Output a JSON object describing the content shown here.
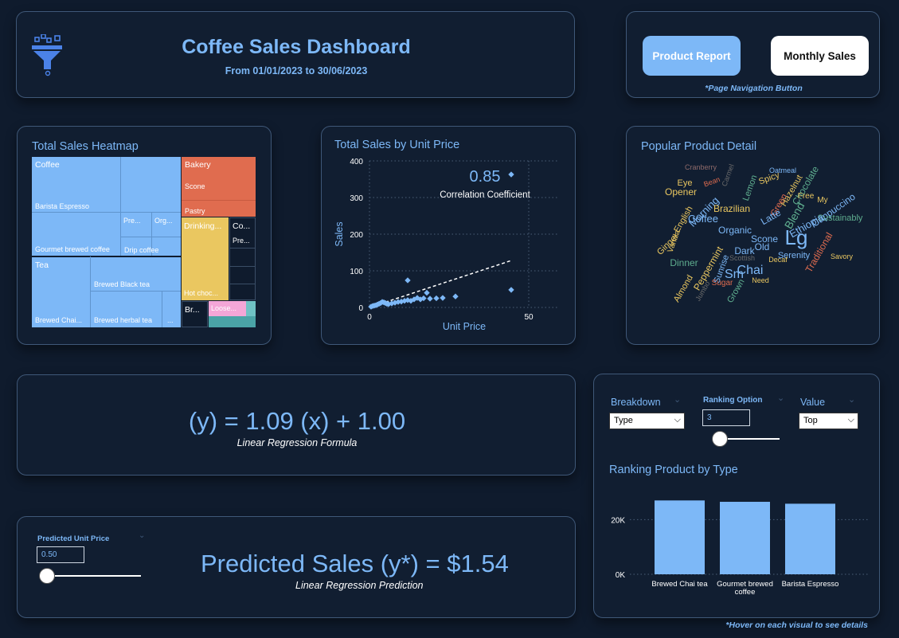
{
  "header": {
    "title": "Coffee Sales Dashboard",
    "subtitle": "From 01/01/2023 to 30/06/2023",
    "logo_icon": "funnel-icon"
  },
  "nav": {
    "product_label": "Product Report",
    "monthly_label": "Monthly Sales",
    "note": "*Page Navigation Button"
  },
  "heatmap": {
    "title": "Total Sales Heatmap",
    "labels": {
      "coffee": "Coffee",
      "barista": "Barista Espresso",
      "pre1": "Pre...",
      "org": "Org...",
      "gourmet": "Gourmet brewed coffee",
      "drip": "Drip coffee",
      "tea": "Tea",
      "black": "Brewed Black tea",
      "chai": "Brewed Chai...",
      "herbal": "Brewed herbal tea",
      "dots": "...",
      "bakery": "Bakery",
      "scone": "Scone",
      "pastry": "Pastry",
      "drinking": "Drinking...",
      "hotchoc": "Hot choc...",
      "co": "Co...",
      "pre2": "Pre...",
      "br": "Br...",
      "loose": "Loose..."
    },
    "colors": {
      "coffee": "#7db8f7",
      "bakery": "#e06c4f",
      "drinking": "#eac760",
      "loose": "#f4a6d7",
      "dark": "#0f1b2d"
    }
  },
  "scatter": {
    "title": "Total Sales by Unit Price",
    "correlation_value": "0.85",
    "correlation_label": "Correlation Coefficient"
  },
  "chart_data": [
    {
      "type": "scatter",
      "title": "Total Sales by Unit Price",
      "xlabel": "Unit Price",
      "ylabel": "Sales",
      "xlim": [
        0,
        50
      ],
      "ylim": [
        0,
        400
      ],
      "xticks": [
        "0",
        "50"
      ],
      "yticks": [
        "0",
        "100",
        "200",
        "300",
        "400"
      ],
      "trendline": [
        [
          0,
          0
        ],
        [
          44.5,
          128
        ]
      ],
      "points": [
        [
          0.5,
          2
        ],
        [
          1,
          4
        ],
        [
          1.5,
          5
        ],
        [
          2,
          6
        ],
        [
          2.5,
          8
        ],
        [
          3,
          10
        ],
        [
          3.5,
          12
        ],
        [
          4,
          15
        ],
        [
          4.5,
          14
        ],
        [
          5,
          12
        ],
        [
          5.5,
          10
        ],
        [
          6,
          9
        ],
        [
          7,
          11
        ],
        [
          8,
          13
        ],
        [
          9,
          15
        ],
        [
          10,
          16
        ],
        [
          11,
          18
        ],
        [
          12,
          20
        ],
        [
          12,
          74
        ],
        [
          13,
          18
        ],
        [
          14,
          22
        ],
        [
          15,
          26
        ],
        [
          16,
          22
        ],
        [
          17,
          25
        ],
        [
          18,
          40
        ],
        [
          19,
          24
        ],
        [
          21,
          25
        ],
        [
          23,
          26
        ],
        [
          27,
          30
        ],
        [
          44.5,
          48
        ],
        [
          44.5,
          363
        ]
      ]
    },
    {
      "type": "bar",
      "title": "Ranking Product by Type",
      "categories": [
        "Brewed Chai tea",
        "Gourmet brewed coffee",
        "Barista Espresso"
      ],
      "values": [
        27000,
        26500,
        25800
      ],
      "ylim": [
        0,
        30000
      ],
      "yticks": [
        "0K",
        "20K"
      ]
    }
  ],
  "wordcloud": {
    "title": "Popular Product Detail",
    "words": [
      {
        "t": "Cranberry",
        "c": "#8e6a6a"
      },
      {
        "t": "Carmel",
        "c": "#6b6b6b"
      },
      {
        "t": "Oatmeal",
        "c": "#7db8f7"
      },
      {
        "t": "Spicy",
        "c": "#eac760"
      },
      {
        "t": "Bean",
        "c": "#e06c4f"
      },
      {
        "t": "Eye",
        "c": "#eac760"
      },
      {
        "t": "Opener",
        "c": "#eac760"
      },
      {
        "t": "Lemon",
        "c": "#5fae8f"
      },
      {
        "t": "Hazelnut",
        "c": "#eac760"
      },
      {
        "t": "Chocolate",
        "c": "#5fae8f"
      },
      {
        "t": "Free",
        "c": "#eac760"
      },
      {
        "t": "My",
        "c": "#eac760"
      },
      {
        "t": "Morning",
        "c": "#7db8f7"
      },
      {
        "t": "Brazilian",
        "c": "#eac760"
      },
      {
        "t": "Green",
        "c": "#e06c4f"
      },
      {
        "t": "Blend",
        "c": "#5fae8f"
      },
      {
        "t": "Cappuccino",
        "c": "#7db8f7"
      },
      {
        "t": "Coffee",
        "c": "#7db8f7"
      },
      {
        "t": "Sustainably",
        "c": "#5fae8f"
      },
      {
        "t": "Organic",
        "c": "#7db8f7"
      },
      {
        "t": "Lg",
        "c": "#7db8f7"
      },
      {
        "t": "Ethiopia",
        "c": "#7db8f7"
      },
      {
        "t": "Vanilla",
        "c": "#eac760"
      },
      {
        "t": "Scone",
        "c": "#7db8f7"
      },
      {
        "t": "Serenity",
        "c": "#7db8f7"
      },
      {
        "t": "Traditional",
        "c": "#e06c4f"
      },
      {
        "t": "Chai",
        "c": "#7db8f7"
      },
      {
        "t": "Dark",
        "c": "#7db8f7"
      },
      {
        "t": "Savory",
        "c": "#eac760"
      },
      {
        "t": "Dinner",
        "c": "#5fae8f"
      },
      {
        "t": "Peppermint",
        "c": "#eac760"
      },
      {
        "t": "Sunrise",
        "c": "#7db8f7"
      },
      {
        "t": "Decaf",
        "c": "#eac760"
      },
      {
        "t": "Almond",
        "c": "#eac760"
      },
      {
        "t": "Sm",
        "c": "#7db8f7"
      },
      {
        "t": "Sugar",
        "c": "#e06c4f"
      },
      {
        "t": "Grown",
        "c": "#5fae8f"
      },
      {
        "t": "Need",
        "c": "#eac760"
      },
      {
        "t": "Scottish",
        "c": "#6b6b6b"
      },
      {
        "t": "Jumbo",
        "c": "#6b6b6b"
      },
      {
        "t": "Ginger",
        "c": "#eac760"
      },
      {
        "t": "English",
        "c": "#eac760"
      },
      {
        "t": "Latte",
        "c": "#7db8f7"
      },
      {
        "t": "Old",
        "c": "#7db8f7"
      }
    ]
  },
  "formula": {
    "text": "(y) = 1.09 (x) + 1.00",
    "caption": "Linear Regression Formula"
  },
  "prediction": {
    "label": "Predicted Unit Price",
    "value": "0.50",
    "slider_fraction": 0,
    "text": "Predicted Sales (y*) = $1.54",
    "caption": "Linear Regression Prediction"
  },
  "ranking": {
    "title": "Ranking Product by Type",
    "breakdown_label": "Breakdown",
    "breakdown_value": "Type",
    "option_label": "Ranking Option",
    "option_value": "3",
    "option_slider_fraction": 0,
    "value_label": "Value",
    "value_value": "Top"
  },
  "footer_note": "*Hover on each visual to see details"
}
